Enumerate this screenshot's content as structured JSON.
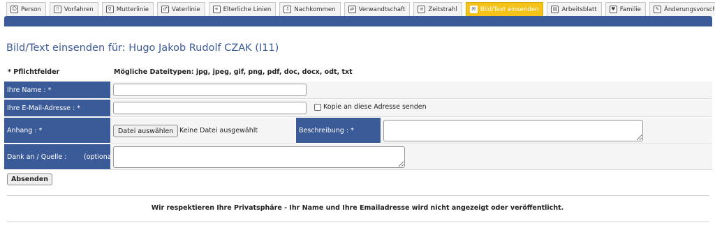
{
  "tabs": [
    {
      "label": "Person",
      "icon": "person-icon",
      "glyph": "☺"
    },
    {
      "label": "Vorfahren",
      "icon": "ancestors-icon",
      "glyph": "⇧"
    },
    {
      "label": "Mutterlinie",
      "icon": "maternal-line-icon",
      "glyph": "♀"
    },
    {
      "label": "Vaterlinie",
      "icon": "paternal-line-icon",
      "glyph": "♂"
    },
    {
      "label": "Elterliche Linien",
      "icon": "parental-lines-icon",
      "glyph": "⚭"
    },
    {
      "label": "Nachkommen",
      "icon": "descendants-icon",
      "glyph": "⇩"
    },
    {
      "label": "Verwandtschaft",
      "icon": "relationship-icon",
      "glyph": "⇄"
    },
    {
      "label": "Zeitstrahl",
      "icon": "timeline-icon",
      "glyph": "≡"
    },
    {
      "label": "Bild/Text einsenden",
      "icon": "upload-icon",
      "glyph": "✉",
      "active": true
    },
    {
      "label": "Arbeitsblatt",
      "icon": "worksheet-icon",
      "glyph": "▤"
    },
    {
      "label": "Familie",
      "icon": "family-icon",
      "glyph": "♥"
    },
    {
      "label": "Änderungsvorschlag",
      "icon": "suggest-change-icon",
      "glyph": "✎"
    }
  ],
  "page_title": "Bild/Text einsenden für: Hugo Jakob Rudolf CZAK (I11)",
  "required_note": "* Pflichtfelder",
  "file_types": "Mögliche Dateitypen: jpg, jpeg, gif, png, pdf, doc, docx, odt, txt",
  "form": {
    "name_label": "Ihre Name : *",
    "email_label": "Ihre E-Mail-Adresse : *",
    "copy_label": "Kopie an diese Adresse senden",
    "attachment_label": "Anhang : *",
    "file_button": "Datei auswählen",
    "file_status": "Keine Datei ausgewählt",
    "description_label": "Beschreibung : *",
    "thanks_label": "Dank an / Quelle :",
    "optional": "(optional)",
    "submit": "Absenden"
  },
  "privacy_note": "Wir respektieren Ihre Privatsphäre - Ihr Name und Ihre Emailadresse wird nicht angezeigt oder veröffentlicht.",
  "colors": {
    "header_blue": "#3b5a98",
    "active_tab": "#f5c21a"
  }
}
